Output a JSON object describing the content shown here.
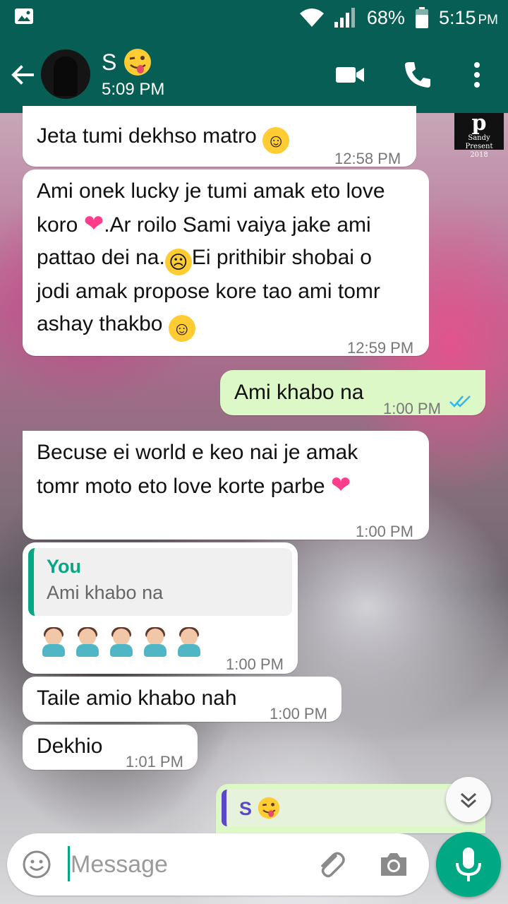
{
  "status_bar": {
    "battery": "68%",
    "time": "5:15",
    "ampm": "PM"
  },
  "header": {
    "contact_name": "S",
    "contact_sub": "5:09 PM"
  },
  "wallpaper_watermark": {
    "mark": "p",
    "line1": "Sandy Present",
    "line2": "2018"
  },
  "messages": [
    {
      "direction": "in",
      "text": "Jeta tumi dekhso matro",
      "time": "12:58 PM"
    },
    {
      "direction": "in",
      "line1": "Ami onek lucky je tumi amak eto love",
      "line2a": "koro",
      "line2b": ".Ar roilo Sami vaiya jake ami",
      "line3a": "pattao dei na.",
      "line3b": "Ei prithibir shobai o",
      "line4": "jodi amak propose kore tao ami tomr",
      "line5": "ashay thakbo",
      "time": "12:59 PM"
    },
    {
      "direction": "out",
      "text": "Ami khabo na",
      "time": "1:00 PM"
    },
    {
      "direction": "in",
      "line1": "Becuse ei world e keo nai je amak",
      "line2": "tomr moto eto love korte parbe",
      "time": "1:00 PM"
    },
    {
      "direction": "in",
      "quote_name": "You",
      "quote_text": "Ami khabo na",
      "time": "1:00 PM"
    },
    {
      "direction": "in",
      "text": "Taile amio khabo nah",
      "time": "1:00 PM"
    },
    {
      "direction": "in",
      "text": "Dekhio",
      "time": "1:01 PM"
    },
    {
      "direction": "out",
      "quote_name": "S"
    }
  ],
  "input": {
    "placeholder": "Message"
  },
  "colors": {
    "header": "#075e54",
    "accent": "#00a884",
    "outgoing": "#dcf8c6",
    "incoming": "#ffffff",
    "tick_read": "#34b7f1"
  }
}
